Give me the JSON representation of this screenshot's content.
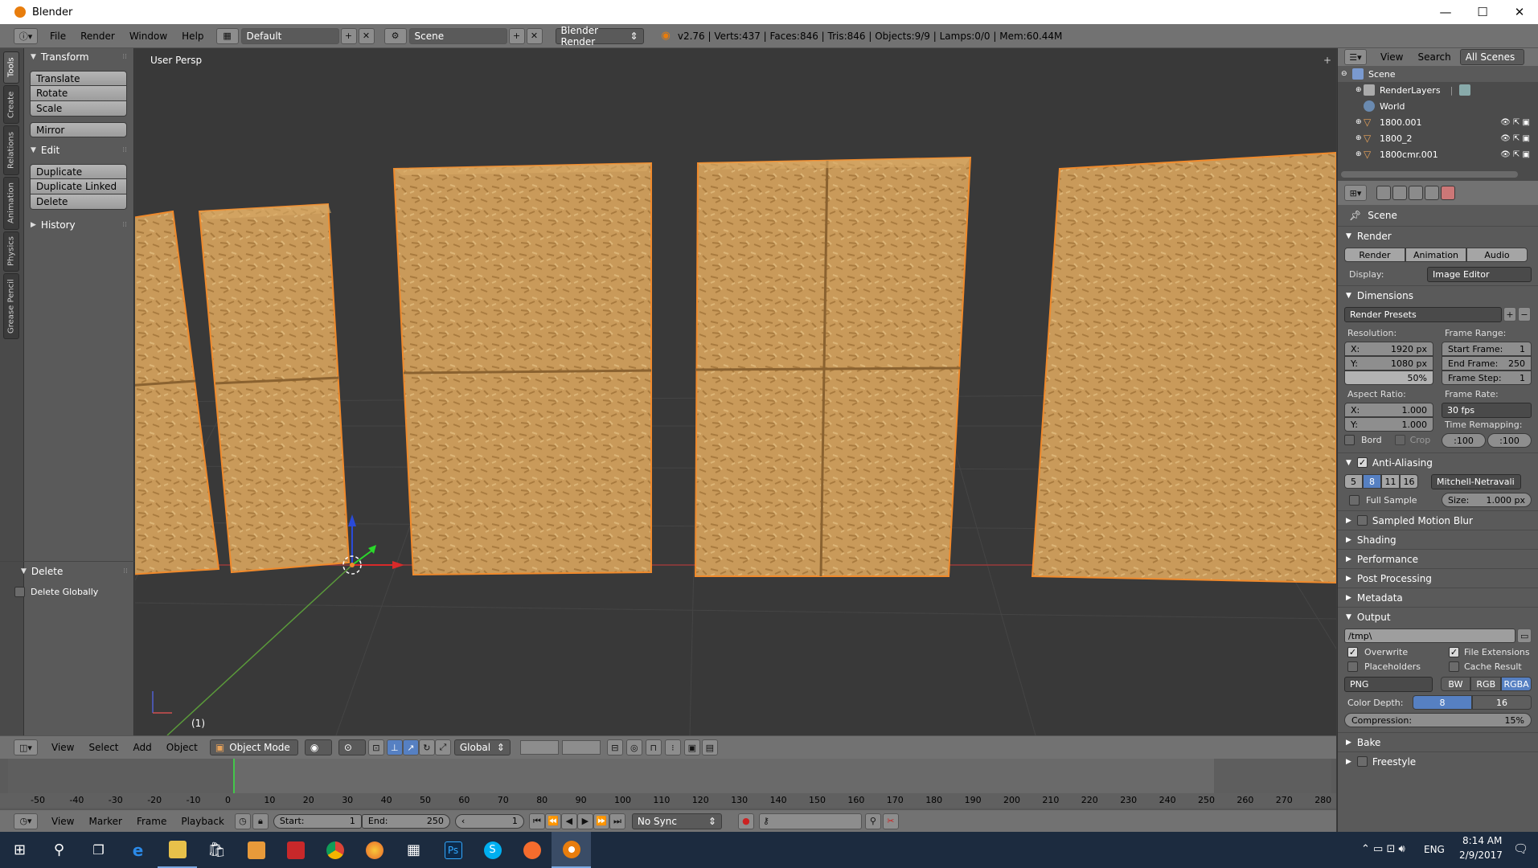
{
  "window": {
    "title": "Blender",
    "minimize": "—",
    "maximize": "☐",
    "close": "✕"
  },
  "info_header": {
    "menus": [
      "File",
      "Render",
      "Window",
      "Help"
    ],
    "screen_layout": "Default",
    "scene": "Scene",
    "engine": "Blender Render",
    "stats": "v2.76 | Verts:437 | Faces:846 | Tris:846 | Objects:9/9 | Lamps:0/0 | Mem:60.44M"
  },
  "tool_tabs": [
    "Tools",
    "Create",
    "Relations",
    "Animation",
    "Physics",
    "Grease Pencil"
  ],
  "tool_shelf": {
    "transform": {
      "title": "Transform",
      "buttons": [
        "Translate",
        "Rotate",
        "Scale",
        "Mirror"
      ]
    },
    "edit": {
      "title": "Edit",
      "buttons": [
        "Duplicate",
        "Duplicate Linked",
        "Delete"
      ]
    },
    "history": {
      "title": "History"
    },
    "operator": {
      "title": "Delete",
      "option": "Delete Globally"
    }
  },
  "viewport": {
    "label": "User Persp",
    "frame_label": "(1)"
  },
  "view3d_header": {
    "menus": [
      "View",
      "Select",
      "Add",
      "Object"
    ],
    "mode": "Object Mode",
    "orientation": "Global"
  },
  "timeline": {
    "ticks": [
      "-50",
      "-40",
      "-30",
      "-20",
      "-10",
      "0",
      "10",
      "20",
      "30",
      "40",
      "50",
      "60",
      "70",
      "80",
      "90",
      "100",
      "110",
      "120",
      "130",
      "140",
      "150",
      "160",
      "170",
      "180",
      "190",
      "200",
      "210",
      "220",
      "230",
      "240",
      "250",
      "260",
      "270",
      "280"
    ],
    "menus": [
      "View",
      "Marker",
      "Frame",
      "Playback"
    ],
    "start_label": "Start:",
    "start_value": "1",
    "end_label": "End:",
    "end_value": "250",
    "current_frame": "1",
    "sync": "No Sync"
  },
  "outliner": {
    "menus": [
      "View",
      "Search"
    ],
    "filter": "All Scenes",
    "items": [
      "Scene",
      "RenderLayers",
      "World",
      "1800.001",
      "1800_2",
      "1800cmr.001"
    ]
  },
  "properties": {
    "context": "Scene",
    "render": {
      "title": "Render",
      "buttons": [
        "Render",
        "Animation",
        "Audio"
      ],
      "display_label": "Display:",
      "display_value": "Image Editor"
    },
    "dimensions": {
      "title": "Dimensions",
      "presets": "Render Presets",
      "resolution_label": "Resolution:",
      "res_x": "X:",
      "res_x_val": "1920 px",
      "res_y": "Y:",
      "res_y_val": "1080 px",
      "res_pct": "50%",
      "frame_range_label": "Frame Range:",
      "start_frame": "Start Frame:",
      "start_frame_val": "1",
      "end_frame": "End Frame:",
      "end_frame_val": "250",
      "frame_step": "Frame Step:",
      "frame_step_val": "1",
      "aspect_label": "Aspect Ratio:",
      "asp_x": "X:",
      "asp_x_val": "1.000",
      "asp_y": "Y:",
      "asp_y_val": "1.000",
      "frame_rate_label": "Frame Rate:",
      "frame_rate": "30 fps",
      "time_remap_label": "Time Remapping:",
      "remap_old": ":100",
      "remap_new": ":100",
      "bord": "Bord",
      "crop": "Crop"
    },
    "anti_aliasing": {
      "title": "Anti-Aliasing",
      "samples": [
        "5",
        "8",
        "11",
        "16"
      ],
      "selected_sample": "8",
      "filter": "Mitchell-Netravali",
      "full_sample": "Full Sample",
      "size": "Size:",
      "size_val": "1.000 px"
    },
    "collapsed_panels": [
      "Sampled Motion Blur",
      "Shading",
      "Performance",
      "Post Processing",
      "Metadata"
    ],
    "output": {
      "title": "Output",
      "path": "/tmp\\",
      "overwrite": "Overwrite",
      "file_extensions": "File Extensions",
      "placeholders": "Placeholders",
      "cache_result": "Cache Result",
      "format": "PNG",
      "color_modes": [
        "BW",
        "RGB",
        "RGBA"
      ],
      "color_mode_selected": "RGBA",
      "color_depth_label": "Color Depth:",
      "depths": [
        "8",
        "16"
      ],
      "compression_label": "Compression:",
      "compression_val": "15%"
    },
    "bottom_panels": [
      "Bake",
      "Freestyle"
    ]
  },
  "taskbar": {
    "time": "8:14 AM",
    "date": "2/9/2017",
    "lang": "ENG",
    "ps_label": "Ps",
    "skype_label": "S"
  },
  "colors": {
    "accent_blue": "#5680c2",
    "panel_wood": "#c99a5a",
    "selection_outline": "#f08a2c",
    "taskbar": "#1c2b3f"
  }
}
